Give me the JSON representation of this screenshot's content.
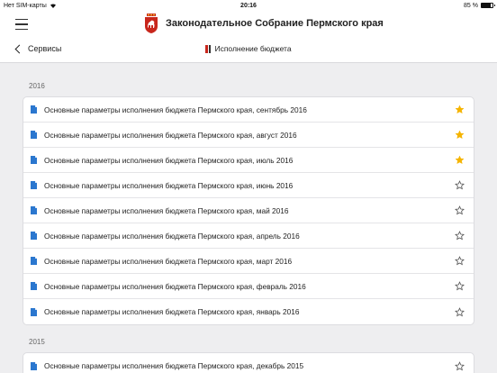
{
  "status_bar": {
    "carrier": "Нет SIM-карты",
    "time": "20:16",
    "battery": "85 %",
    "battery_level": 0.85
  },
  "header": {
    "app_title": "Законодательное Собрание Пермского края",
    "back_label": "Сервисы",
    "section_title": "Исполнение бюджета"
  },
  "colors": {
    "doc_icon": "#2b77cf",
    "star_filled": "#f5b400",
    "star_empty": "#555555",
    "crest_red": "#c8261c"
  },
  "groups": [
    {
      "year": "2016",
      "items": [
        {
          "label": "Основные параметры исполнения бюджета Пермского края, сентябрь 2016",
          "favorite": true
        },
        {
          "label": "Основные параметры исполнения бюджета Пермского края, август 2016",
          "favorite": true
        },
        {
          "label": "Основные параметры исполнения бюджета Пермского края, июль 2016",
          "favorite": true
        },
        {
          "label": "Основные параметры исполнения бюджета Пермского края, июнь 2016",
          "favorite": false
        },
        {
          "label": "Основные параметры исполнения бюджета Пермского края, май 2016",
          "favorite": false
        },
        {
          "label": "Основные параметры исполнения бюджета Пермского края, апрель 2016",
          "favorite": false
        },
        {
          "label": "Основные параметры исполнения бюджета Пермского края, март 2016",
          "favorite": false
        },
        {
          "label": "Основные параметры исполнения бюджета Пермского края, февраль 2016",
          "favorite": false
        },
        {
          "label": "Основные параметры исполнения бюджета Пермского края, январь 2016",
          "favorite": false
        }
      ]
    },
    {
      "year": "2015",
      "items": [
        {
          "label": "Основные параметры исполнения бюджета Пермского края, декабрь 2015",
          "favorite": false
        }
      ]
    }
  ]
}
